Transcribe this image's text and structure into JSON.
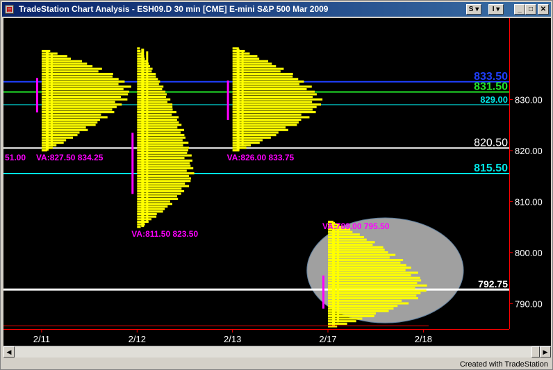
{
  "window": {
    "title": "TradeStation Chart Analysis - ESH09.D  30 min  [CME] E-mini S&P 500 Mar 2009",
    "s_button": "S",
    "i_button": "I",
    "credit": "Created with TradeStation"
  },
  "colors": {
    "background": "#000000",
    "profile": "#ffff00",
    "value_area": "#ff00ff",
    "axis": "#ff0000",
    "price_axis_text": "#ffffff",
    "highlight": "#a0a0a0"
  },
  "chart_data": {
    "type": "market-profile",
    "ylim": [
      785,
      846
    ],
    "y_ticks": [
      "790.00",
      "800.00",
      "810.00",
      "820.00",
      "830.00"
    ],
    "x_ticks": [
      {
        "label": "2/11",
        "day": 1
      },
      {
        "label": "2/12",
        "day": 2
      },
      {
        "label": "2/13",
        "day": 3
      },
      {
        "label": "2/17",
        "day": 4
      },
      {
        "label": "2/18",
        "day": 5
      }
    ],
    "x_range": [
      0.6,
      5.9
    ],
    "levels": [
      {
        "price": 833.5,
        "label": "833.50",
        "color": "#1f3fff",
        "thickness": 2,
        "bold": true,
        "size": 16
      },
      {
        "price": 831.5,
        "label": "831.50",
        "color": "#22e82a",
        "thickness": 2,
        "bold": true,
        "size": 16
      },
      {
        "price": 829.0,
        "label": "829.00",
        "color": "#00e5e5",
        "thickness": 1,
        "bold": true,
        "size": 13
      },
      {
        "price": 820.5,
        "label": "820.50",
        "color": "#ffffff",
        "thickness": 2,
        "bold": false,
        "size": 16
      },
      {
        "price": 815.5,
        "label": "815.50",
        "color": "#00e5e5",
        "thickness": 2,
        "bold": true,
        "size": 16
      },
      {
        "price": 792.75,
        "label": "792.75",
        "color": "#ffffff",
        "thickness": 3,
        "bold": true,
        "size": 14
      }
    ],
    "profiles": [
      {
        "day": 1,
        "low": 820.0,
        "high": 839.5,
        "poc": 832.0,
        "width": 0.95,
        "va_low": 827.5,
        "va_high": 834.25,
        "va_label": "VA:827.50 834.25"
      },
      {
        "day": 2,
        "low": 805.0,
        "high": 840.0,
        "poc": 815.5,
        "width": 0.6,
        "va_low": 811.5,
        "va_high": 823.5,
        "va_label": "VA:811.50 823.50"
      },
      {
        "day": 3,
        "low": 820.0,
        "high": 840.0,
        "poc": 829.5,
        "width": 0.95,
        "va_low": 826.0,
        "va_high": 833.75,
        "va_label": "VA:826.00 833.75"
      },
      {
        "day": 4,
        "low": 785.5,
        "high": 806.0,
        "poc": 792.75,
        "width": 1.05,
        "va_low": 789.0,
        "va_high": 795.5,
        "va_label": "VA:789.00 795.50"
      }
    ],
    "left_partial_label": "51.00",
    "highlight_circle": {
      "day": 4.6,
      "price": 796.5,
      "rx_days": 0.82,
      "ry_price": 10.3
    }
  }
}
